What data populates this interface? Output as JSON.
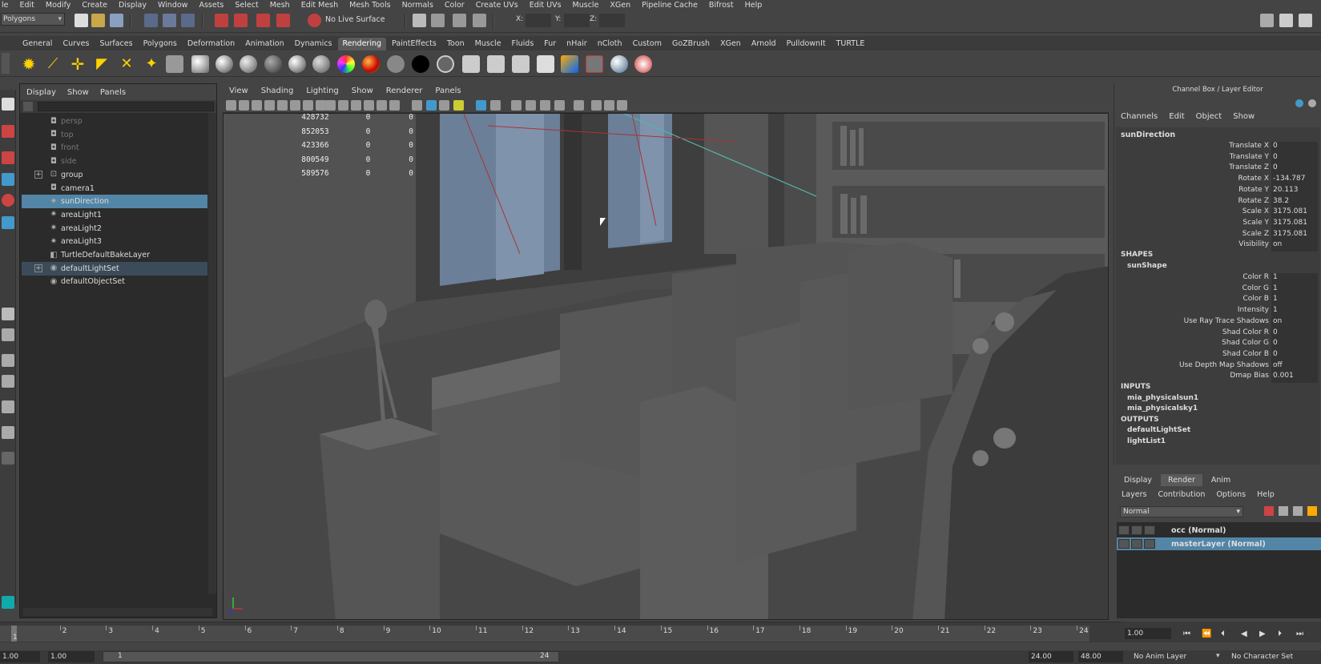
{
  "menubar": [
    "le",
    "Edit",
    "Modify",
    "Create",
    "Display",
    "Window",
    "Assets",
    "Select",
    "Mesh",
    "Edit Mesh",
    "Mesh Tools",
    "Normals",
    "Color",
    "Create UVs",
    "Edit UVs",
    "Muscle",
    "XGen",
    "Pipeline Cache",
    "Bifrost",
    "Help"
  ],
  "statusline": {
    "mode": "Polygons",
    "live_surface": "No Live Surface",
    "x_label": "X:",
    "y_label": "Y:",
    "z_label": "Z:"
  },
  "shelf_tabs": [
    "General",
    "Curves",
    "Surfaces",
    "Polygons",
    "Deformation",
    "Animation",
    "Dynamics",
    "Rendering",
    "PaintEffects",
    "Toon",
    "Muscle",
    "Fluids",
    "Fur",
    "nHair",
    "nCloth",
    "Custom",
    "GoZBrush",
    "XGen",
    "Arnold",
    "PulldownIt",
    "TURTLE"
  ],
  "shelf_active": "Rendering",
  "outliner": {
    "menu": [
      "Display",
      "Show",
      "Panels"
    ],
    "items": [
      {
        "label": "persp",
        "expand": false,
        "dim": true,
        "icon": "camera-icon"
      },
      {
        "label": "top",
        "expand": false,
        "dim": true,
        "icon": "camera-icon"
      },
      {
        "label": "front",
        "expand": false,
        "dim": true,
        "icon": "camera-icon"
      },
      {
        "label": "side",
        "expand": false,
        "dim": true,
        "icon": "camera-icon"
      },
      {
        "label": "group",
        "expand": true,
        "dim": false,
        "icon": "transform-icon"
      },
      {
        "label": "camera1",
        "expand": false,
        "dim": false,
        "icon": "camera-icon"
      },
      {
        "label": "sunDirection",
        "expand": false,
        "dim": false,
        "icon": "light-icon",
        "selected": true
      },
      {
        "label": "areaLight1",
        "expand": false,
        "dim": false,
        "icon": "light-icon"
      },
      {
        "label": "areaLight2",
        "expand": false,
        "dim": false,
        "icon": "light-icon"
      },
      {
        "label": "areaLight3",
        "expand": false,
        "dim": false,
        "icon": "light-icon"
      },
      {
        "label": "TurtleDefaultBakeLayer",
        "expand": false,
        "dim": false,
        "icon": "node-icon"
      },
      {
        "label": "defaultLightSet",
        "expand": true,
        "dim": false,
        "icon": "set-icon",
        "selected2": true
      },
      {
        "label": "defaultObjectSet",
        "expand": false,
        "dim": false,
        "icon": "set-icon"
      }
    ]
  },
  "viewport": {
    "menu": [
      "View",
      "Shading",
      "Lighting",
      "Show",
      "Renderer",
      "Panels"
    ],
    "hud": [
      {
        "v1": "428732",
        "v2": "0",
        "v3": "0"
      },
      {
        "v1": "852053",
        "v2": "0",
        "v3": "0"
      },
      {
        "v1": "423366",
        "v2": "0",
        "v3": "0"
      },
      {
        "v1": "800549",
        "v2": "0",
        "v3": "0"
      },
      {
        "v1": "589576",
        "v2": "0",
        "v3": "0"
      }
    ]
  },
  "channelbox": {
    "title": "Channel Box / Layer Editor",
    "menu": [
      "Channels",
      "Edit",
      "Object",
      "Show"
    ],
    "object": "sunDirection",
    "attrs": [
      {
        "name": "Translate X",
        "value": "0"
      },
      {
        "name": "Translate Y",
        "value": "0"
      },
      {
        "name": "Translate Z",
        "value": "0"
      },
      {
        "name": "Rotate X",
        "value": "-134.787"
      },
      {
        "name": "Rotate Y",
        "value": "20.113"
      },
      {
        "name": "Rotate Z",
        "value": "38.2"
      },
      {
        "name": "Scale X",
        "value": "3175.081"
      },
      {
        "name": "Scale Y",
        "value": "3175.081"
      },
      {
        "name": "Scale Z",
        "value": "3175.081"
      },
      {
        "name": "Visibility",
        "value": "on"
      }
    ],
    "shapes_header": "SHAPES",
    "shape_name": "sunShape",
    "shape_attrs": [
      {
        "name": "Color R",
        "value": "1"
      },
      {
        "name": "Color G",
        "value": "1"
      },
      {
        "name": "Color B",
        "value": "1"
      },
      {
        "name": "Intensity",
        "value": "1"
      },
      {
        "name": "Use Ray Trace Shadows",
        "value": "on"
      },
      {
        "name": "Shad Color R",
        "value": "0"
      },
      {
        "name": "Shad Color G",
        "value": "0"
      },
      {
        "name": "Shad Color B",
        "value": "0"
      },
      {
        "name": "Use Depth Map Shadows",
        "value": "off"
      },
      {
        "name": "Dmap Bias",
        "value": "0.001"
      }
    ],
    "inputs_header": "INPUTS",
    "inputs": [
      "mia_physicalsun1",
      "mia_physicalsky1"
    ],
    "outputs_header": "OUTPUTS",
    "outputs": [
      "defaultLightSet",
      "lightList1"
    ]
  },
  "layereditor": {
    "tabs": [
      "Display",
      "Render",
      "Anim"
    ],
    "active_tab": "Render",
    "menu": [
      "Layers",
      "Contribution",
      "Options",
      "Help"
    ],
    "blend_mode": "Normal",
    "layers": [
      {
        "name": "occ (Normal)",
        "selected": false
      },
      {
        "name": "masterLayer (Normal)",
        "selected": true
      }
    ]
  },
  "timeline": {
    "ticks": [
      "1",
      "2",
      "3",
      "4",
      "5",
      "6",
      "7",
      "8",
      "9",
      "10",
      "11",
      "12",
      "13",
      "14",
      "15",
      "16",
      "17",
      "18",
      "19",
      "20",
      "21",
      "22",
      "23",
      "24"
    ],
    "current_frame": "1",
    "current_field": "1.00"
  },
  "range": {
    "start": "1.00",
    "min": "1.00",
    "bar_start": "1",
    "bar_end": "24",
    "end": "24.00",
    "max": "48.00",
    "anim_layer": "No Anim Layer",
    "character_set": "No Character Set"
  }
}
